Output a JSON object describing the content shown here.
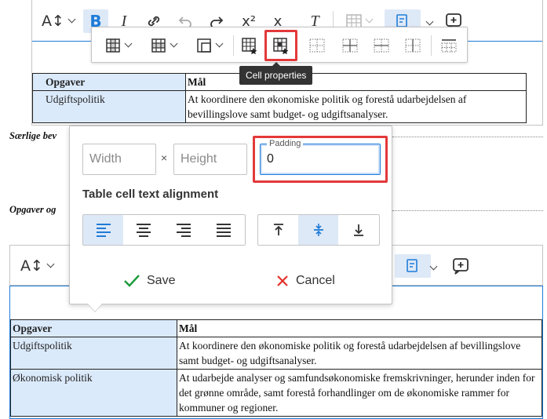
{
  "top_editor": {
    "toolbar": {
      "text_size_icon": "A↕",
      "bold": "B",
      "italic": "I"
    },
    "table": {
      "header": [
        "Opgaver",
        "Mål"
      ],
      "rows": [
        [
          "Udgiftspolitik",
          "At koordinere den økonomiske politik og forestå udarbejdelsen af bevillingslove samt budget- og udgiftsanalyser."
        ]
      ]
    }
  },
  "table_toolbar": {
    "tooltip": "Cell properties"
  },
  "background_text": {
    "line1": "Særlige bev",
    "line2": "Opgaver og"
  },
  "cell_panel": {
    "width_placeholder": "Width",
    "times": "×",
    "height_placeholder": "Height",
    "padding_label": "Padding",
    "padding_value": "0",
    "alignment_title": "Table cell text alignment",
    "save_label": "Save",
    "cancel_label": "Cancel",
    "colors": {
      "save": "#1c9b3c",
      "cancel": "#e2322a",
      "accent": "#1f7cd8",
      "highlight": "#e3393a"
    }
  },
  "bottom_editor": {
    "table": {
      "header": [
        "Opgaver",
        "Mål"
      ],
      "rows": [
        [
          "Udgiftspolitik",
          "At koordinere den økonomiske politik og forestå udarbejdelsen af bevillingslove samt budget- og udgiftsanalyser."
        ],
        [
          "Økonomisk politik",
          "At udarbejde analyser og samfundsøkonomiske fremskrivninger, herunder inden for det grønne område, samt forestå forhandlinger om de økonomiske rammer for kommuner og regioner."
        ]
      ]
    }
  }
}
